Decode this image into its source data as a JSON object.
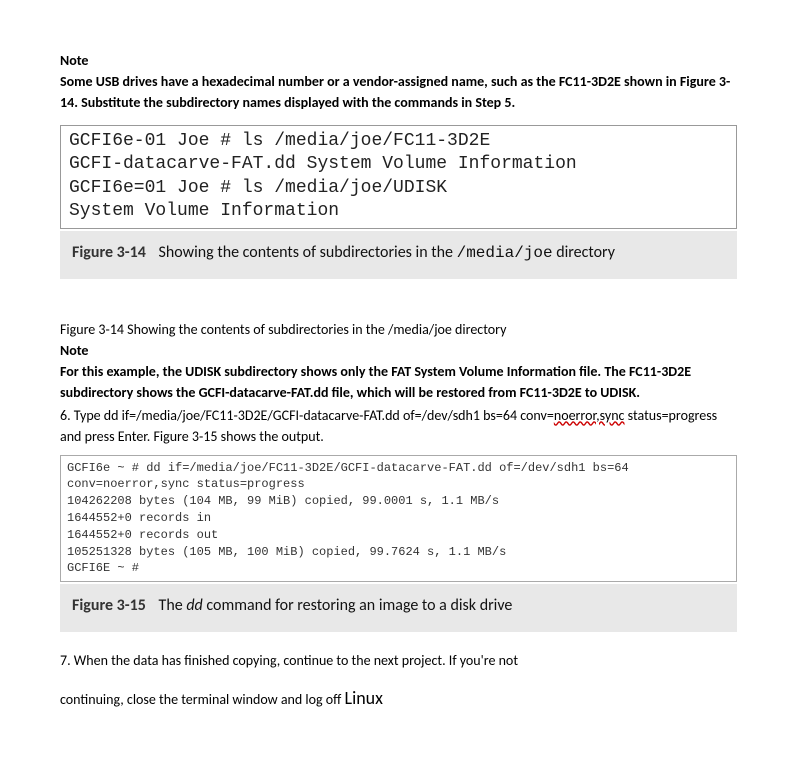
{
  "note1_label": "Note",
  "note1_text": "Some USB drives have a hexadecimal number or a vendor-assigned name, such as the FC11-3D2E shown in Figure 3-14. Substitute the subdirectory names displayed with the commands in Step 5.",
  "code1": {
    "line1": "GCFI6e-01 Joe # ls /media/joe/FC11-3D2E",
    "line2": "GCFI-datacarve-FAT.dd  System Volume Information",
    "line3": "GCFI6e=01 Joe # ls /media/joe/UDISK",
    "line4": "System Volume Information"
  },
  "fig14": {
    "label": "Figure 3-14",
    "text_pre": "Showing the contents of subdirectories in the ",
    "path": "/media/joe",
    "text_post": " directory"
  },
  "fig14_repeat": "Figure 3-14 Showing the contents of subdirectories in the /media/joe directory",
  "note2_label": "Note",
  "note2_text": "For this example, the UDISK subdirectory shows only the FAT System Volume Information file. The FC11-3D2E subdirectory shows the GCFI-datacarve-FAT.dd file, which will be restored from FC11-3D2E to UDISK.",
  "step6_a": "6. Type dd if=/media/joe/FC11-3D2E/GCFI-datacarve-FAT.dd of=/dev/sdh1 bs=64 conv=",
  "step6_squiggle": "noerror,sync",
  "step6_b": " status=progress and press Enter. Figure 3-15 shows the output.",
  "code2": {
    "line1": "GCFI6e ~ # dd if=/media/joe/FC11-3D2E/GCFI-datacarve-FAT.dd of=/dev/sdh1 bs=64",
    "line2": "conv=noerror,sync status=progress",
    "line3": "104262208 bytes (104 MB, 99 MiB) copied, 99.0001 s, 1.1 MB/s",
    "line4": "1644552+0 records in",
    "line5": "1644552+0 records out",
    "line6": "105251328 bytes (105 MB, 100 MiB) copied, 99.7624 s, 1.1 MB/s",
    "line7": "GCFI6E ~ #"
  },
  "fig15": {
    "label": "Figure 3-15",
    "text_pre": "The ",
    "cmd": "dd",
    "text_post": " command for restoring an image to a disk drive"
  },
  "step7_a": "7. When the data has finished copying, continue to the next project. If you're not",
  "step7_b": "continuing, close the terminal window and log off ",
  "linux": "Linux"
}
